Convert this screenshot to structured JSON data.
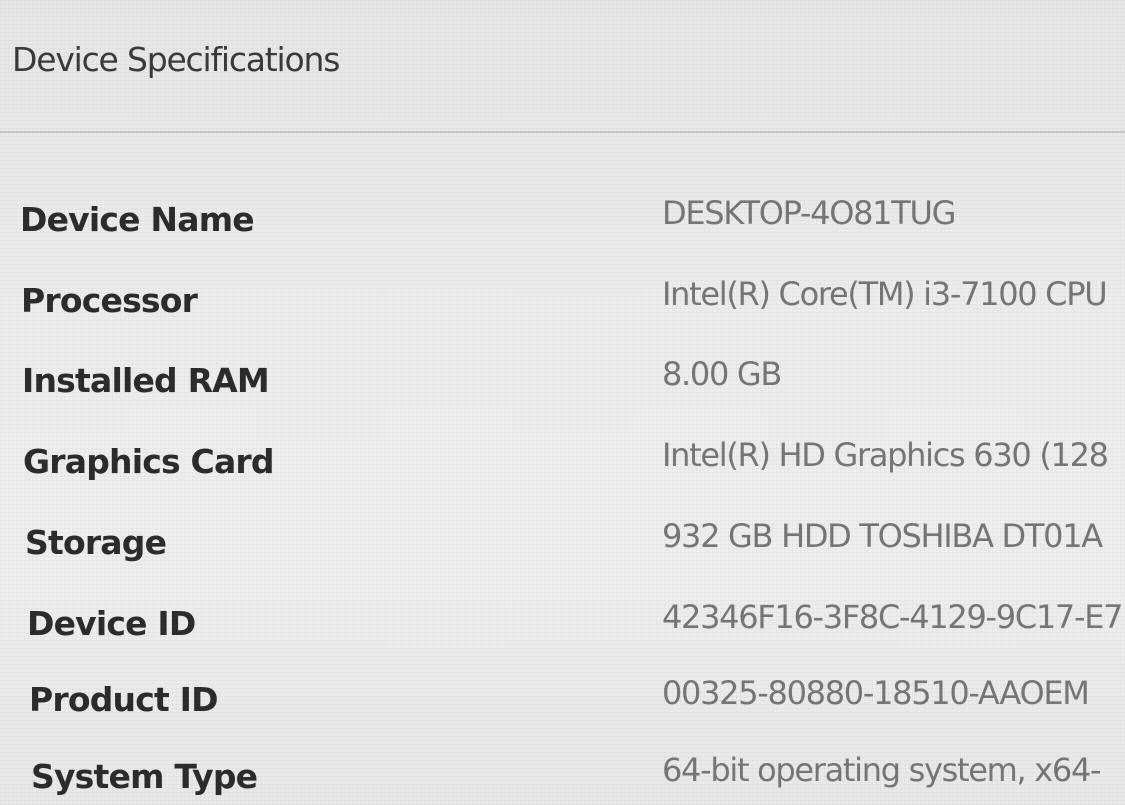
{
  "section": {
    "title": "Device Specifications"
  },
  "specs": [
    {
      "label": "Device Name",
      "value": "DESKTOP-4O81TUG"
    },
    {
      "label": "Processor",
      "value": "Intel(R) Core(TM) i3-7100 CPU"
    },
    {
      "label": "Installed RAM",
      "value": "8.00 GB"
    },
    {
      "label": "Graphics Card",
      "value": "Intel(R) HD Graphics 630 (128"
    },
    {
      "label": "Storage",
      "value": "932 GB HDD TOSHIBA DT01A"
    },
    {
      "label": "Device ID",
      "value": "42346F16-3F8C-4129-9C17-E7"
    },
    {
      "label": "Product ID",
      "value": "00325-80880-18510-AAOEM"
    },
    {
      "label": "System Type",
      "value": "64-bit operating system, x64-"
    }
  ]
}
